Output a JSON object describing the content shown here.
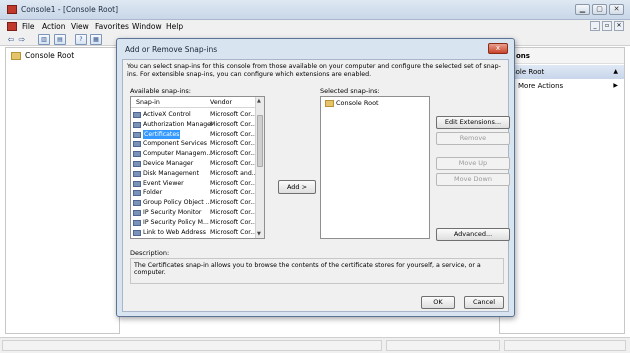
{
  "window": {
    "title": "Console1 - [Console Root]"
  },
  "menu": [
    "File",
    "Action",
    "View",
    "Favorites",
    "Window",
    "Help"
  ],
  "tree": {
    "root": "Console Root"
  },
  "actions": {
    "header": "ons",
    "subheader": "sole Root",
    "more": "More Actions"
  },
  "dialog": {
    "title": "Add or Remove Snap-ins",
    "close": "x",
    "intro": "You can select snap-ins for this console from those available on your computer and configure the selected set of snap-ins. For extensible snap-ins, you can configure which extensions are enabled.",
    "available_label": "Available snap-ins:",
    "selected_label": "Selected snap-ins:",
    "columns": {
      "snapin": "Snap-in",
      "vendor": "Vendor"
    },
    "available": [
      {
        "name": "ActiveX Control",
        "vendor": "Microsoft Cor..."
      },
      {
        "name": "Authorization Manager",
        "vendor": "Microsoft Cor..."
      },
      {
        "name": "Certificates",
        "vendor": "Microsoft Cor...",
        "selected": true
      },
      {
        "name": "Component Services",
        "vendor": "Microsoft Cor..."
      },
      {
        "name": "Computer Managem...",
        "vendor": "Microsoft Cor..."
      },
      {
        "name": "Device Manager",
        "vendor": "Microsoft Cor..."
      },
      {
        "name": "Disk Management",
        "vendor": "Microsoft and..."
      },
      {
        "name": "Event Viewer",
        "vendor": "Microsoft Cor..."
      },
      {
        "name": "Folder",
        "vendor": "Microsoft Cor..."
      },
      {
        "name": "Group Policy Object ...",
        "vendor": "Microsoft Cor..."
      },
      {
        "name": "IP Security Monitor",
        "vendor": "Microsoft Cor..."
      },
      {
        "name": "IP Security Policy M...",
        "vendor": "Microsoft Cor..."
      },
      {
        "name": "Link to Web Address",
        "vendor": "Microsoft Cor..."
      }
    ],
    "selected": [
      "Console Root"
    ],
    "add_button": "Add >",
    "edit_extensions": "Edit Extensions...",
    "remove": "Remove",
    "move_up": "Move Up",
    "move_down": "Move Down",
    "advanced": "Advanced...",
    "description_label": "Description:",
    "description": "The Certificates snap-in allows you to browse the contents of the certificate stores for yourself, a service, or a computer.",
    "ok": "OK",
    "cancel": "Cancel"
  }
}
